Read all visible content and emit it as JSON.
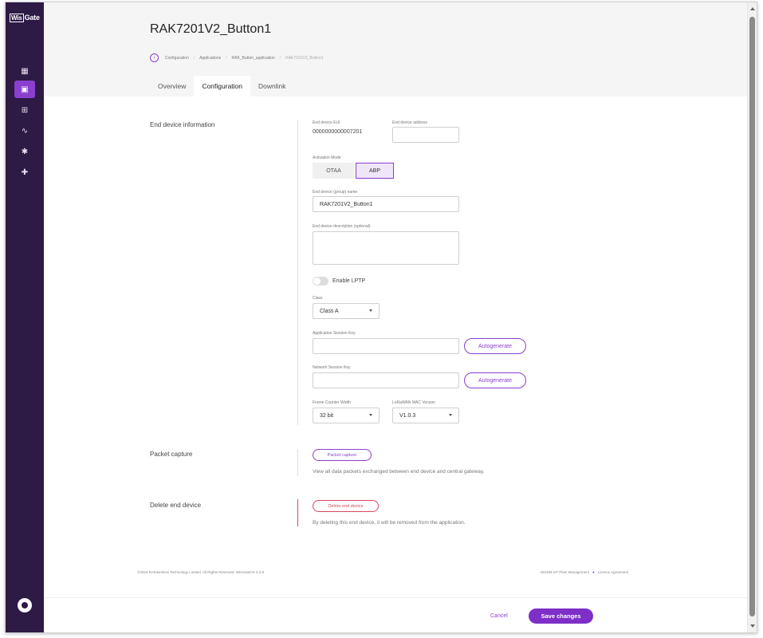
{
  "sidebar": {
    "logo_prefix": "Wis",
    "logo_suffix": "Gate",
    "items": [
      {
        "icon": "dashboard-icon",
        "glyph": "▦"
      },
      {
        "icon": "device-icon",
        "glyph": "▣"
      },
      {
        "icon": "network-icon",
        "glyph": "⊞"
      },
      {
        "icon": "activity-icon",
        "glyph": "∿"
      },
      {
        "icon": "settings-icon",
        "glyph": "✱"
      },
      {
        "icon": "extensions-icon",
        "glyph": "✚"
      }
    ],
    "avatar_icon": "user-icon"
  },
  "header": {
    "title": "RAK7201V2_Button1",
    "breadcrumb": [
      "Configuration",
      "Applications",
      "RAK_Button_application",
      "RAK7201V2_Button1"
    ],
    "tabs": [
      "Overview",
      "Configuration",
      "Downlink"
    ],
    "active_tab": "Configuration"
  },
  "device_info": {
    "section_label": "End device information",
    "eui_label": "End device EUI",
    "eui_value": "0000000000007201",
    "address_label": "End device address",
    "address_value": "",
    "activation_label": "Activation Mode",
    "activation_options": [
      "OTAA",
      "ABP"
    ],
    "activation_selected": "ABP",
    "name_label": "End device (group) name",
    "name_value": "RAK7201V2_Button1",
    "description_label": "End device description (optional)",
    "description_value": "",
    "lptp_label": "Enable LPTP",
    "lptp_enabled": false,
    "class_label": "Class",
    "class_value": "Class A",
    "app_key_label": "Application Session Key",
    "app_key_value": "",
    "net_key_label": "Network Session Key",
    "net_key_value": "",
    "autogenerate_label": "Autogenerate",
    "fcnt_label": "Frame Counter Width",
    "fcnt_value": "32 bit",
    "mac_label": "LoRaWAN MAC Version",
    "mac_value": "V1.0.3"
  },
  "packet_capture": {
    "section_label": "Packet capture",
    "button_label": "Packet capture",
    "description": "View all data packets exchanged between end device and central gateway."
  },
  "delete_device": {
    "section_label": "Delete end device",
    "button_label": "Delete end device",
    "description": "By deleting this end device, it will be removed from the application."
  },
  "footer": {
    "copyright": "©2024 RAKwireless Technology Limited. All Rights Reserved. WisGateOS 2.2.8",
    "link1": "WisDM IoT Fleet Management",
    "link2": "Licence Agreement"
  },
  "actions": {
    "cancel_label": "Cancel",
    "save_label": "Save changes"
  },
  "colors": {
    "sidebar_bg": "#2d1a45",
    "accent": "#8b3fcf",
    "danger": "#d9485f"
  }
}
